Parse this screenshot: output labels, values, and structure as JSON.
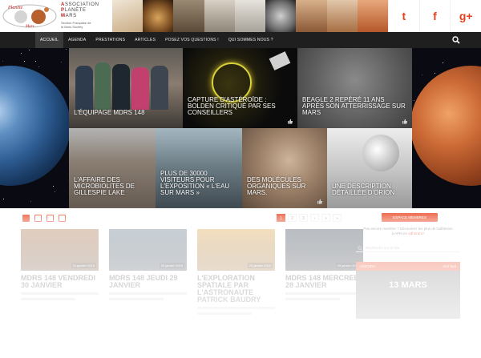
{
  "header": {
    "org_lines": [
      {
        "cap": "A",
        "rest": "SSOCIATION"
      },
      {
        "cap": "P",
        "rest": "LANÈTE"
      },
      {
        "cap": "M",
        "rest": "ARS"
      }
    ],
    "org_sub_1": "Section Française de",
    "org_sub_2": "la Mars Society",
    "logo_text_1": "Planète",
    "logo_text_2": "Mars",
    "social": [
      {
        "name": "twitter",
        "glyph": "t"
      },
      {
        "name": "facebook",
        "glyph": "f"
      },
      {
        "name": "google-plus",
        "glyph": "g+"
      }
    ]
  },
  "nav": {
    "items": [
      {
        "label": "ACCUEIL",
        "active": true
      },
      {
        "label": "AGENDA",
        "active": false
      },
      {
        "label": "PRESTATIONS",
        "active": false
      },
      {
        "label": "ARTICLES",
        "active": false
      },
      {
        "label": "POSEZ VOS QUESTIONS !",
        "active": false
      },
      {
        "label": "QUI SOMMES NOUS ?",
        "active": false
      }
    ]
  },
  "hero": {
    "tiles": [
      {
        "title": "L'ÉQUIPAGE MDRS 148"
      },
      {
        "title": "CAPTURE D'ASTÉROÏDE : BOLDEN CRITIQUÉ PAR SES CONSEILLERS"
      },
      {
        "title": "BEAGLE 2 REPÉRÉ 11 ANS APRÈS SON ATTERRISSAGE SUR MARS"
      },
      {
        "title": "L'AFFAIRE DES MICROBIOLITES DE GILLESPIE LAKE"
      },
      {
        "title": "PLUS DE 30000 VISITEURS POUR L'EXPOSITION « L'EAU SUR MARS »"
      },
      {
        "title": "DES MOLÉCULES ORGANIQUES SUR MARS."
      },
      {
        "title": "UNE DESCRIPTION DÉTAILLÉE D'ORION"
      }
    ]
  },
  "pager": {
    "pages": [
      "1",
      "2",
      "3",
      "›",
      "»",
      "»"
    ]
  },
  "articles": [
    {
      "title": "MDRS 148 VENDREDI 30 JANVIER",
      "date": "31 janvier 2015"
    },
    {
      "title": "MDRS 148 JEUDI 29 JANVIER",
      "date": "30 janvier 2015"
    },
    {
      "title": "L'EXPLORATION SPATIALE PAR L'ASTRONAUTE PATRICK BAUDRY",
      "date": "29 janvier 2015"
    },
    {
      "title": "MDRS 148 MERCREDI 28 JANVIER",
      "date": "29 janvier 2015"
    }
  ],
  "sidebar": {
    "members_label": "ESPACE MEMBRES",
    "members_text_1": "Pas encore membre ? Découvrez les plus de l'adhésion",
    "members_text_2": "à APM en",
    "members_link": "adhérant !",
    "search_placeholder": "Recherche sur le site",
    "agenda_label": "AGENDA",
    "agenda_more": "Voir tout",
    "agenda_date": "13 MARS"
  },
  "colors": {
    "accent": "#e8401c",
    "nav_bg": "#1f1f1f"
  }
}
